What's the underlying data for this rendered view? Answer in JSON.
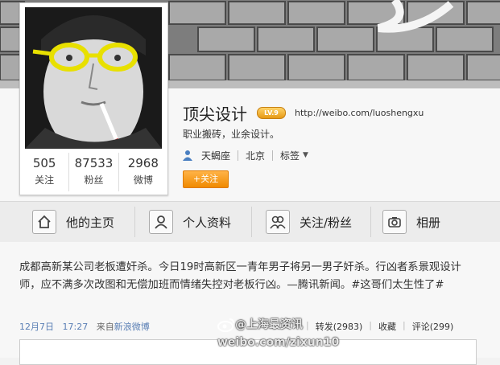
{
  "profile": {
    "name": "顶尖设计",
    "vip_level": "LV.9",
    "url": "http://weibo.com/luoshengxu",
    "bio": "职业搬砖，业余设计。",
    "zodiac": "天蝎座",
    "location": "北京",
    "tags_label": "标签",
    "follow_label": "+关注"
  },
  "stats": [
    {
      "value": "505",
      "label": "关注"
    },
    {
      "value": "87533",
      "label": "粉丝"
    },
    {
      "value": "2968",
      "label": "微博"
    }
  ],
  "tabs": [
    {
      "label": "他的主页",
      "icon": "home-icon"
    },
    {
      "label": "个人资料",
      "icon": "person-icon"
    },
    {
      "label": "关注/粉丝",
      "icon": "people-icon"
    },
    {
      "label": "相册",
      "icon": "camera-icon"
    }
  ],
  "post": {
    "text": "成都高新某公司老板遭奸杀。今日19时高新区一青年男子将另一男子奸杀。行凶者系景观设计师，应不满多次改图和无偿加班而情绪失控对老板行凶。—腾讯新闻。#这哥们太生性了#",
    "date": "12月7日",
    "time": "17:27",
    "source_prefix": "来自",
    "source": "新浪微博",
    "forward_label": "转发(2983)",
    "favorite_label": "收藏",
    "comment_label": "评论(299)"
  },
  "watermark": {
    "line1": "@上海最资讯",
    "line2": "weibo.com/zixun10"
  },
  "colors": {
    "accent_orange": "#f08a00",
    "link_blue": "#5a7fb5",
    "glasses_yellow": "#e8e000"
  }
}
